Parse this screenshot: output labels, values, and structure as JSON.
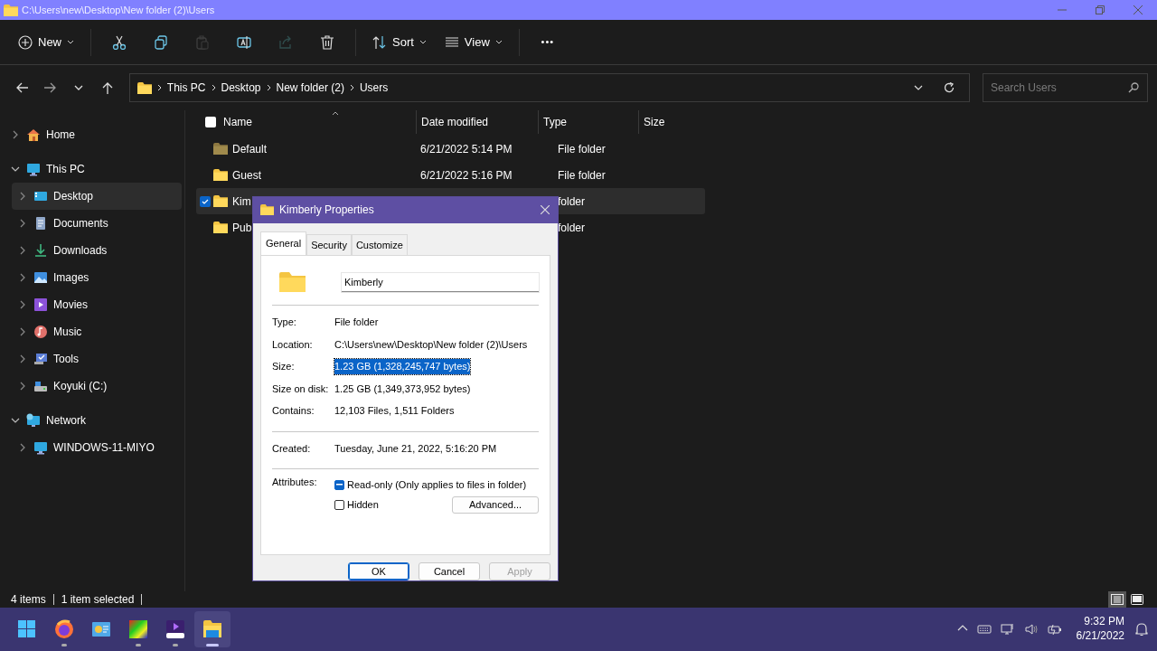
{
  "window": {
    "title": "C:\\Users\\new\\Desktop\\New folder (2)\\Users"
  },
  "toolbar": [
    {
      "kind": "new",
      "label": "New",
      "disabled": false
    },
    {
      "kind": "cut",
      "disabled": false
    },
    {
      "kind": "copy",
      "disabled": false
    },
    {
      "kind": "paste",
      "disabled": true
    },
    {
      "kind": "rename",
      "disabled": false
    },
    {
      "kind": "share",
      "disabled": true
    },
    {
      "kind": "delete",
      "disabled": false
    },
    {
      "kind": "sort",
      "label": "Sort",
      "disabled": false
    },
    {
      "kind": "view",
      "label": "View",
      "disabled": false
    },
    {
      "kind": "more",
      "label": "•••",
      "disabled": false
    }
  ],
  "address_bar": {
    "crumbs": [
      "This PC",
      "Desktop",
      "New folder (2)",
      "Users"
    ]
  },
  "search": {
    "placeholder": "Search Users"
  },
  "sidebar": {
    "items": [
      {
        "label": "Home",
        "kind": "home",
        "expanded": false,
        "selected": false
      },
      {
        "label": "This PC",
        "kind": "pc",
        "expanded": true,
        "selected": false,
        "children": [
          {
            "label": "Desktop",
            "kind": "desktop",
            "expanded": false,
            "selected": true
          },
          {
            "label": "Documents",
            "kind": "documents",
            "expanded": false,
            "selected": false
          },
          {
            "label": "Downloads",
            "kind": "downloads",
            "expanded": false,
            "selected": false
          },
          {
            "label": "Images",
            "kind": "images",
            "expanded": false,
            "selected": false
          },
          {
            "label": "Movies",
            "kind": "movies",
            "expanded": false,
            "selected": false
          },
          {
            "label": "Music",
            "kind": "music",
            "expanded": false,
            "selected": false
          },
          {
            "label": "Tools",
            "kind": "tools",
            "expanded": false,
            "selected": false
          },
          {
            "label": "Koyuki (C:)",
            "kind": "drive",
            "expanded": false,
            "selected": false
          }
        ]
      },
      {
        "label": "Network",
        "kind": "network",
        "expanded": true,
        "selected": false,
        "children": [
          {
            "label": "WINDOWS-11-MIYO",
            "kind": "pc",
            "expanded": false,
            "selected": false
          }
        ]
      }
    ]
  },
  "table": {
    "select_all": {
      "checked": false
    },
    "columns": [
      "Name",
      "Date modified",
      "Type",
      "Size"
    ],
    "rows": [
      {
        "name": "Default",
        "date_modified": "6/21/2022 5:14 PM",
        "type": "File folder",
        "dimmed": true,
        "selected": false
      },
      {
        "name": "Guest",
        "date_modified": "6/21/2022 5:16 PM",
        "type": "File folder",
        "dimmed": false,
        "selected": false
      },
      {
        "name": "Kim",
        "type": "folder",
        "dimmed": false,
        "selected": true
      },
      {
        "name": "Pub",
        "type": "folder",
        "dimmed": false,
        "selected": false
      }
    ]
  },
  "status_bar": {
    "items": [
      "4 items",
      "1 item selected"
    ],
    "views": [
      {
        "kind": "details",
        "selected": true
      },
      {
        "kind": "tiles",
        "selected": false
      }
    ]
  },
  "dialog": {
    "title": "Kimberly Properties",
    "tabs": [
      {
        "label": "General",
        "selected": true
      },
      {
        "label": "Security",
        "selected": false
      },
      {
        "label": "Customize",
        "selected": false
      }
    ],
    "name_field": {
      "value": "Kimberly"
    },
    "sections": [
      [
        {
          "label": "Type:",
          "value": "File folder",
          "highlighted": false
        },
        {
          "label": "Location:",
          "value": "C:\\Users\\new\\Desktop\\New folder (2)\\Users",
          "highlighted": false
        },
        {
          "label": "Size:",
          "value": "1.23 GB (1,328,245,747 bytes)",
          "highlighted": true
        },
        {
          "label": "Size on disk:",
          "value": "1.25 GB (1,349,373,952 bytes)",
          "highlighted": false
        },
        {
          "label": "Contains:",
          "value": "12,103 Files, 1,511 Folders",
          "highlighted": false
        }
      ],
      [
        {
          "label": "Created:",
          "value": "Tuesday, June 21, 2022, 5:16:20 PM",
          "highlighted": false
        }
      ]
    ],
    "attributes": {
      "label": "Attributes:",
      "options": [
        {
          "label": "Read-only (Only applies to files in folder)",
          "checked": false,
          "indeterminate": true
        },
        {
          "label": "Hidden",
          "checked": false,
          "indeterminate": false
        }
      ],
      "advanced_button": "Advanced..."
    },
    "buttons": [
      {
        "label": "OK",
        "default": true,
        "disabled": false
      },
      {
        "label": "Cancel",
        "default": false,
        "disabled": false
      },
      {
        "label": "Apply",
        "default": false,
        "disabled": true
      }
    ]
  },
  "taskbar": {
    "apps": [
      {
        "kind": "start",
        "running": false,
        "active": false
      },
      {
        "kind": "firefox",
        "running": true,
        "active": false
      },
      {
        "kind": "chart",
        "running": false,
        "active": false
      },
      {
        "kind": "gradient",
        "running": true,
        "active": false
      },
      {
        "kind": "media",
        "running": true,
        "active": false
      },
      {
        "kind": "explorer",
        "running": true,
        "active": true
      }
    ],
    "tray": [
      {
        "kind": "chevron"
      },
      {
        "kind": "keyboard"
      },
      {
        "kind": "network"
      },
      {
        "kind": "volume"
      },
      {
        "kind": "battery"
      }
    ],
    "time": "9:32 PM",
    "date": "6/21/2022"
  }
}
